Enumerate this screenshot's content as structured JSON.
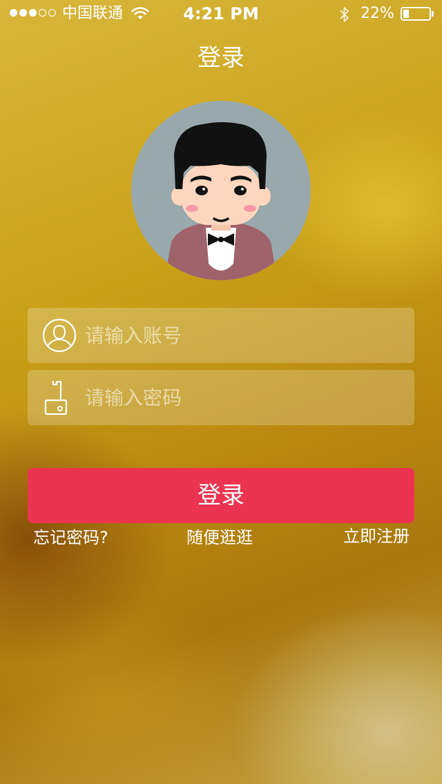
{
  "status_bar": {
    "carrier": "中国联通",
    "time": "4:21 PM",
    "battery_percent": "22%",
    "battery_level": 0.22,
    "signal_bars_filled": 3,
    "signal_bars_total": 5,
    "icons": [
      "wifi-icon",
      "bluetooth-icon",
      "battery-icon"
    ]
  },
  "header": {
    "title": "登录"
  },
  "avatar": {
    "icon": "user-avatar-illustration",
    "colors": {
      "background": "#99a8ac",
      "hair": "#111111",
      "skin": "#fdd6bd",
      "jacket": "#a0636b",
      "cheeks": "#f59aa5"
    }
  },
  "form": {
    "username": {
      "placeholder": "请输入账号",
      "value": "",
      "icon": "user-icon"
    },
    "password": {
      "placeholder": "请输入密码",
      "value": "",
      "icon": "key-icon"
    },
    "login_button": "登录"
  },
  "links": {
    "forgot_password": "忘记密码?",
    "browse": "随便逛逛",
    "register": "立即注册"
  },
  "colors": {
    "accent": "#ec3450",
    "background_gold": "#c9a018",
    "field_bg": "rgba(255,255,255,0.22)"
  }
}
